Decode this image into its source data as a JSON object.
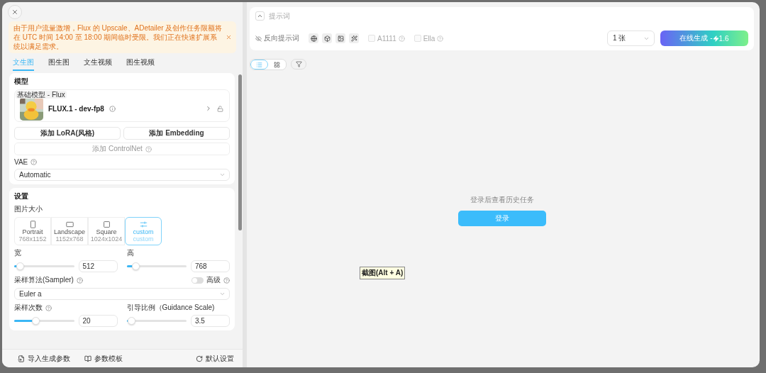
{
  "notice": {
    "text": "由于用户流量激增，Flux 的 Upscale、ADetailer 及创作任务限额将在 UTC 时间 14:00 至 18:00 期间临时受限。我们正在快速扩展系统以满足需求。"
  },
  "tabs": [
    {
      "label": "文生图",
      "selected": true
    },
    {
      "label": "图生图",
      "selected": false
    },
    {
      "label": "文生视频",
      "selected": false
    },
    {
      "label": "图生视频",
      "selected": false
    }
  ],
  "model": {
    "heading": "模型",
    "badge": "基础模型 - Flux",
    "name": "FLUX.1 - dev-fp8",
    "buttons": [
      "添加 LoRA(风格)",
      "添加 Embedding"
    ],
    "controlnet": "添加 ControlNet",
    "vae_label": "VAE",
    "vae_value": "Automatic"
  },
  "settings": {
    "heading": "设置",
    "size_label": "图片大小",
    "sizes": [
      {
        "label": "Portrait",
        "dims": "768x1152",
        "selected": false
      },
      {
        "label": "Landscape",
        "dims": "1152x768",
        "selected": false
      },
      {
        "label": "Square",
        "dims": "1024x1024",
        "selected": false
      },
      {
        "label": "custom",
        "dims": "custom",
        "selected": true
      }
    ],
    "sliders": [
      {
        "label": "宽",
        "value": "512",
        "level": 0.1
      },
      {
        "label": "高",
        "value": "768",
        "level": 0.15
      }
    ],
    "sampler_label": "采样算法(Sampler)",
    "advanced_label": "高级",
    "advanced_on": false,
    "sampler_value": "Euler a",
    "sliders2": [
      {
        "label": "采样次数",
        "help": true,
        "value": "20",
        "level": 0.35
      },
      {
        "label": "引导比例（Guidance Scale)",
        "help": false,
        "value": "3.5",
        "level": 0.08
      }
    ]
  },
  "footer": {
    "import": "导入生成参数",
    "template": "参数模板",
    "reset": "默认设置"
  },
  "prompt": {
    "placeholder": "提示词",
    "negative": "反向提示词",
    "options": [
      {
        "label": "A1111",
        "checked": false
      },
      {
        "label": "Ella",
        "checked": false
      }
    ],
    "count": "1 张",
    "generate": "在线生成 - ",
    "cost": "1.6"
  },
  "view_toggle": [
    {
      "kind": "list",
      "selected": true
    },
    {
      "kind": "grid",
      "selected": false
    }
  ],
  "history": {
    "message": "登录后查看历史任务",
    "login": "登录"
  },
  "tooltip": "截图(Alt + A)"
}
